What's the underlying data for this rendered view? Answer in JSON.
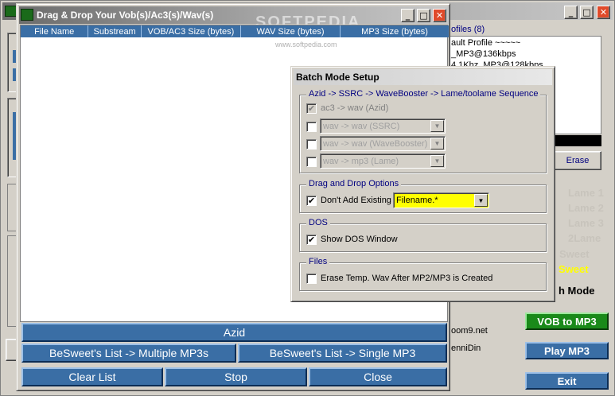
{
  "dragdrop": {
    "title": "Drag & Drop Your Vob(s)/Ac3(s)/Wav(s)",
    "columns": [
      "File Name",
      "Substream",
      "VOB/AC3 Size (bytes)",
      "WAV Size (bytes)",
      "MP3 Size (bytes)"
    ],
    "buttons": {
      "azid": "Azid",
      "multiple": "BeSweet's List -> Multiple MP3s",
      "single": "BeSweet's List -> Single MP3",
      "clear": "Clear List",
      "stop": "Stop",
      "close": "Close"
    }
  },
  "main": {
    "profiles_label": "ofiles (8)",
    "profiles": [
      "ault Profile ~~~~~",
      "_MP3@136kbps",
      "4.1Khz_MP3@128kbps"
    ],
    "erase_label": "Erase",
    "lame_buttons": [
      "Lame 1",
      "Lame 2",
      "Lame 3",
      "2Lame"
    ],
    "sweet_disabled": "Sweet",
    "sweet_label": "Sweet",
    "batch_mode_label": "h Mode",
    "vob_to_mp3": "VOB to MP3",
    "play_mp3": "Play MP3",
    "exit": "Exit",
    "credit1": "oom9.net",
    "credit2": "enniDin",
    "watermark": "SOFTPEDIA",
    "watermark_url": "www.softpedia.com"
  },
  "batch": {
    "title": "Batch Mode Setup",
    "sequence_legend": "Azid -> SSRC -> WaveBooster -> Lame/toolame Sequence",
    "ac3_wav": "ac3 -> wav (Azid)",
    "combo_ssrc": "wav -> wav (SSRC)",
    "combo_wavebooster": "wav -> wav (WaveBooster)",
    "combo_lame": "wav -> mp3 (Lame)",
    "dragdrop_legend": "Drag and Drop Options",
    "dont_add": "Don't Add Existing",
    "filename_value": "Filename.*",
    "dos_legend": "DOS",
    "show_dos": "Show DOS Window",
    "files_legend": "Files",
    "erase_temp": "Erase Temp. Wav After MP2/MP3 is Created"
  },
  "colors": {
    "blue_button": "#3a6ea5",
    "green_button": "#1a8a1a",
    "filename_bg": "#ffff00",
    "close_button": "#e04a2a"
  }
}
